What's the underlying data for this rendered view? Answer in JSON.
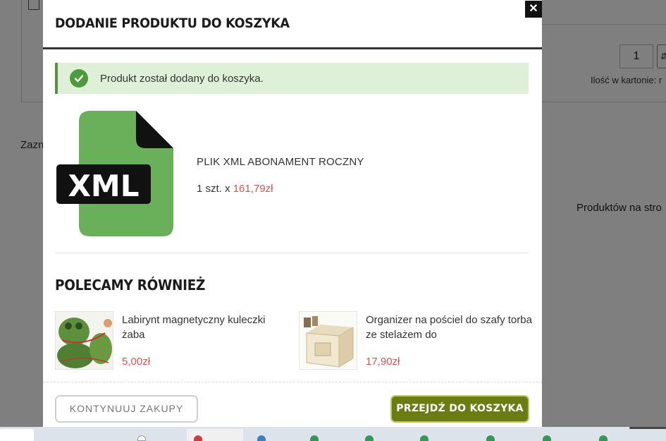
{
  "background_page": {
    "qty_value": "1",
    "carton_label": "Ilość w kartonie: r",
    "side_text": "Zazn",
    "per_page_label": "Produktów na stro"
  },
  "modal": {
    "title": "DODANIE PRODUKTU DO KOSZYKA",
    "close_icon": "close-icon",
    "close_glyph": "✕",
    "success_message": "Produkt został dodany do koszyka.",
    "product": {
      "image_text": "XML",
      "name": "PLIK XML ABONAMENT ROCZNY",
      "qty_prefix": "1 szt. x ",
      "price": "161,79zł"
    },
    "recommended_title": "POLECAMY RÓWNIEŻ",
    "recommended": [
      {
        "name": "Labirynt magnetyczny kuleczki żaba",
        "price": "5,00zł"
      },
      {
        "name": "Organizer na pościel do szafy torba ze stelażem do",
        "price": "17,90zł"
      }
    ],
    "continue_label": "KONTYNUUJ ZAKUPY",
    "go_to_cart_label": "PRZEJDŹ DO KOSZYKA"
  },
  "colors": {
    "accent_green": "#6a7c12",
    "success_bg": "#dff0d8",
    "price_red": "#d9534f",
    "file_icon_green": "#6aaf5a"
  }
}
